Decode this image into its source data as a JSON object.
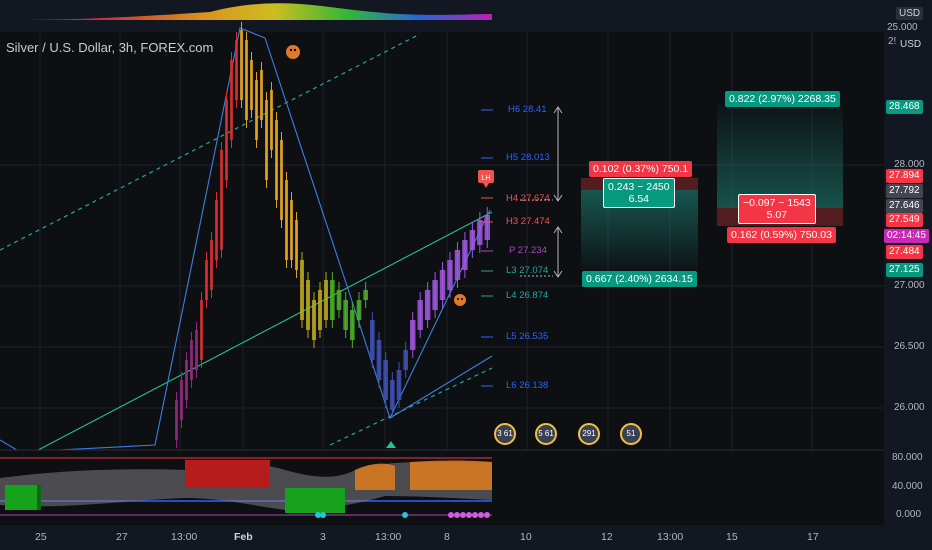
{
  "chart_title": "Silver / U.S. Dollar, 3h, FOREX.com",
  "currency_top": "USD",
  "currency_axis": "USD",
  "top_axis_value": "25.000",
  "axis_partial": "2!",
  "colors": {
    "green_box": "#1b6e63",
    "red_box": "#8a2a2a",
    "teal": "#089981",
    "red": "#f23645",
    "pivot_blue": "#2962ff",
    "pivot_red": "#ef5350",
    "pivot_green": "#26a69a"
  },
  "price_axis": {
    "ticks": [
      "28.000",
      "27.000",
      "26.500",
      "26.000"
    ],
    "indicator_ticks": [
      "80.000",
      "40.000",
      "0.000"
    ],
    "tags": [
      {
        "text": "28.468",
        "color": "#089981"
      },
      {
        "text": "27.894",
        "color": "#f23645"
      },
      {
        "text": "27.792",
        "color": "#434651"
      },
      {
        "text": "27.646",
        "color": "#434651"
      },
      {
        "text": "27.549",
        "color": "#f23645"
      },
      {
        "text": "27.484",
        "color": "#f23645"
      },
      {
        "text": "02:14:45",
        "color": "#c828b4"
      },
      {
        "text": "27.125",
        "color": "#089981"
      }
    ]
  },
  "pivots": [
    {
      "label": "H6 28.41"
    },
    {
      "label": "H5 28.013"
    },
    {
      "label": "H4 27.674"
    },
    {
      "label": "H3 27.474"
    },
    {
      "label": "P 27.234"
    },
    {
      "label": "L3 27.074"
    },
    {
      "label": "L4 26.874"
    },
    {
      "label": "L5 26.535"
    },
    {
      "label": "L6 26.138"
    }
  ],
  "long_position": {
    "stop": "0.102 (0.37%) 750.1",
    "center_line1": "0.243 ~ 2450",
    "center_line2": "6.54",
    "target": "0.667 (2.40%) 2634.15"
  },
  "short_position": {
    "target": "0.822 (2.97%) 2268.35",
    "center_line1": "−0.097 ~ 1543",
    "center_line2": "5.07",
    "stop": "0.162 (0.59%) 750.03"
  },
  "time_axis": [
    "25",
    "27",
    "13:00",
    "Feb",
    "3",
    "13:00",
    "8",
    "10",
    "12",
    "13:00",
    "15",
    "17"
  ],
  "events": [
    {
      "text": "3 61"
    },
    {
      "text": "5 61"
    },
    {
      "text": "291"
    },
    {
      "text": "51"
    }
  ],
  "marker_label": "LH"
}
